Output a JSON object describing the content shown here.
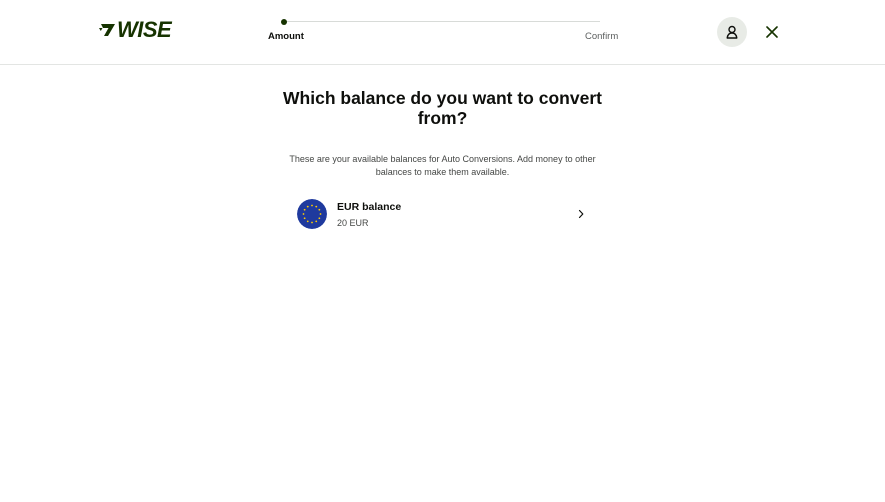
{
  "header": {
    "logo_text": "WISE",
    "brand_color": "#163300",
    "steps": [
      {
        "label": "Amount",
        "state": "active"
      },
      {
        "label": "Confirm",
        "state": "inactive"
      }
    ],
    "profile_icon": "person-icon",
    "close_icon": "close-icon"
  },
  "main": {
    "title": "Which balance do you want to convert from?",
    "subtitle": "These are your available balances for Auto Conversions. Add money to other balances to make them available.",
    "balances": [
      {
        "name": "EUR balance",
        "amount": "20 EUR",
        "flag_icon": "eu-flag-icon",
        "chevron_icon": "chevron-right-icon"
      }
    ]
  }
}
